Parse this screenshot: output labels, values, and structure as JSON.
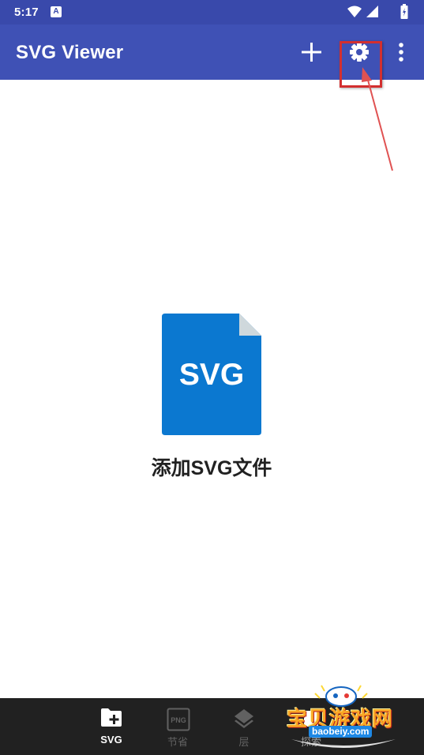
{
  "status_bar": {
    "time": "5:17",
    "notification_icon": "A",
    "icons": [
      "wifi-icon",
      "signal-icon",
      "battery-icon"
    ]
  },
  "app_bar": {
    "title": "SVG Viewer",
    "actions": [
      "add-icon",
      "settings-icon",
      "more-vert-icon"
    ],
    "color": "#3f51b5"
  },
  "empty_state": {
    "file_icon_text": "SVG",
    "label": "添加SVG文件",
    "icon_color": "#0b78d0"
  },
  "bottom_nav": {
    "items": [
      {
        "label": "SVG",
        "icon": "folder-add-icon",
        "active": true
      },
      {
        "label": "节省",
        "icon": "png-icon",
        "icon_text": "PNG",
        "active": false
      },
      {
        "label": "层",
        "icon": "layers-icon",
        "active": false
      },
      {
        "label": "探索",
        "icon": "explore-icon",
        "active": false
      }
    ]
  },
  "annotation": {
    "color": "#d32f2f"
  },
  "watermark": {
    "text": "宝贝游戏网",
    "url": "baobeiy.com"
  }
}
